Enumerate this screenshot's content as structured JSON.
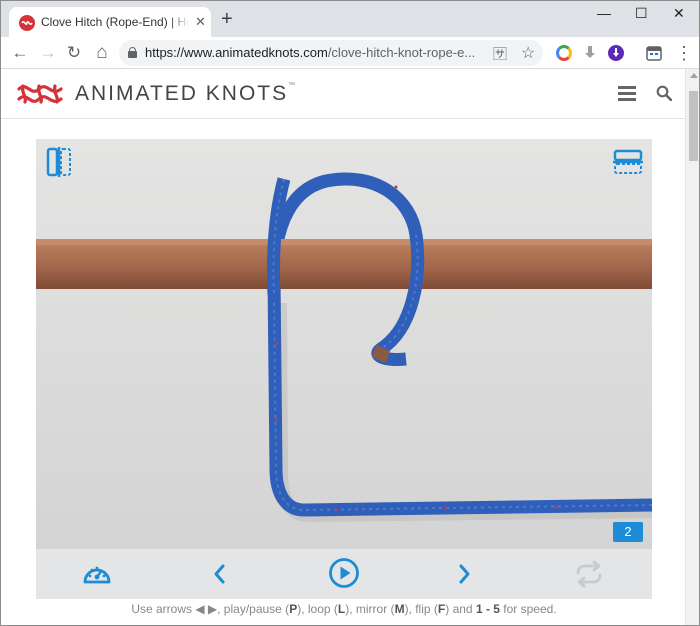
{
  "browser": {
    "tab_title": "Clove Hitch (Rope-End) | How t",
    "tab_close": "✕",
    "new_tab": "+",
    "window_controls": {
      "minimize": "—",
      "maximize": "☐",
      "close": "✕"
    },
    "nav": {
      "back": "←",
      "forward": "→",
      "reload": "↻",
      "home": "⌂"
    },
    "url_host": "https://www.animatedknots.com",
    "url_path": "/clove-hitch-knot-rope-e...",
    "omnibox_icons": {
      "translate": "🈂",
      "star": "☆"
    },
    "menu": "⋮"
  },
  "site": {
    "logo_text": "ANIMATED KNOTS",
    "logo_tm": "™"
  },
  "player": {
    "frame_number": "2",
    "rope_color": "#2f5fb8",
    "pole_color": "#a86d4e",
    "background_color": "#dcdcdb"
  },
  "hint": {
    "prefix": "Use arrows ◀ ▶, play/pause (",
    "p": "P",
    "loop_pre": "), loop (",
    "l": "L",
    "mirror_pre": "), mirror (",
    "m": "M",
    "flip_pre": "), flip (",
    "f": "F",
    "and_pre": ") and ",
    "speed_keys": "1 - 5",
    "suffix": " for speed."
  },
  "colors": {
    "accent": "#1d8bd6",
    "logo_red": "#d6323a"
  }
}
